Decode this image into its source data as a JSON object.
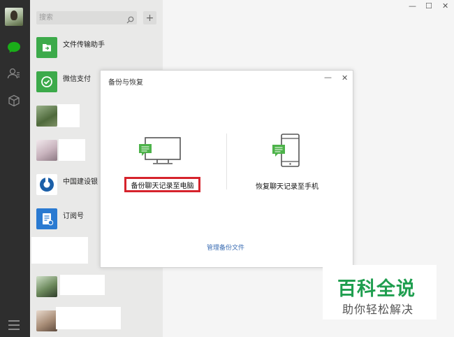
{
  "search": {
    "placeholder": "搜索"
  },
  "chats": [
    {
      "name": "文件传输助手",
      "avatar": "file-transfer-icon",
      "color": "#3caa4a"
    },
    {
      "name": "微信支付",
      "avatar": "wechat-pay-icon",
      "color": "#3caa4a"
    },
    {
      "name": "",
      "avatar": "photo-avatar"
    },
    {
      "name": "",
      "avatar": "photo-avatar"
    },
    {
      "name": "中国建设银",
      "avatar": "ccb-logo-icon",
      "color": "#1b5fa8"
    },
    {
      "name": "订阅号",
      "avatar": "subscription-icon",
      "color": "#2a7ad1"
    },
    {
      "name": "",
      "avatar": "photo-avatar"
    },
    {
      "name": "",
      "avatar": "photo-avatar"
    }
  ],
  "dialog": {
    "title": "备份与恢复",
    "backup_to_pc": "备份聊天记录至电脑",
    "restore_to_phone": "恢复聊天记录至手机",
    "manage_backup": "管理备份文件",
    "highlight_color": "#d6232c"
  },
  "watermark": {
    "title": "百科全说",
    "subtitle": "助你轻松解决",
    "color": "#1f9e4f"
  },
  "colors": {
    "rail": "#2e2e2e",
    "list": "#e9e9e8",
    "accent": "#3caa4a",
    "link": "#3b6db3"
  }
}
